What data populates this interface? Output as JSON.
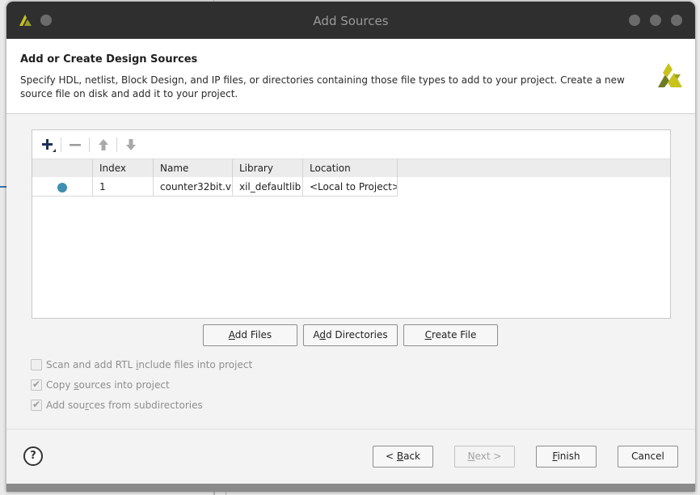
{
  "window": {
    "title": "Add Sources"
  },
  "header": {
    "title": "Add or Create Design Sources",
    "description": "Specify HDL, netlist, Block Design, and IP files, or directories containing those file types to add to your project. Create a new source file on disk and add it to your project."
  },
  "toolbar": {
    "add": "add-icon",
    "remove": "remove-icon",
    "move_up": "arrow-up-icon",
    "move_down": "arrow-down-icon"
  },
  "table": {
    "columns": [
      "",
      "Index",
      "Name",
      "Library",
      "Location"
    ],
    "rows": [
      {
        "status": "status-dot-icon",
        "index": "1",
        "name": "counter32bit.v",
        "library": "xil_defaultlib",
        "location": "<Local to Project>"
      }
    ]
  },
  "actions": {
    "add_files": {
      "pre": "",
      "mn": "A",
      "post": "dd Files"
    },
    "add_directories": {
      "pre": "A",
      "mn": "d",
      "post": "d Directories"
    },
    "create_file": {
      "pre": "",
      "mn": "C",
      "post": "reate File"
    }
  },
  "options": [
    {
      "pre": "Scan and add RTL ",
      "mn": "i",
      "post": "nclude files into project",
      "checked": false
    },
    {
      "pre": "Copy ",
      "mn": "s",
      "post": "ources into project",
      "checked": true
    },
    {
      "pre": "Add sou",
      "mn": "r",
      "post": "ces from subdirectories",
      "checked": true
    }
  ],
  "footer": {
    "help": "?",
    "back": {
      "pre": "< ",
      "mn": "B",
      "post": "ack"
    },
    "next": {
      "pre": "",
      "mn": "N",
      "post": "ext >"
    },
    "finish": {
      "pre": "",
      "mn": "F",
      "post": "inish"
    },
    "cancel": "Cancel"
  },
  "colors": {
    "titlebar": "#2f2f2f",
    "status_dot": "#3e8fb0",
    "logo_yellow": "#c8c21c",
    "logo_olive": "#6f7a22"
  }
}
